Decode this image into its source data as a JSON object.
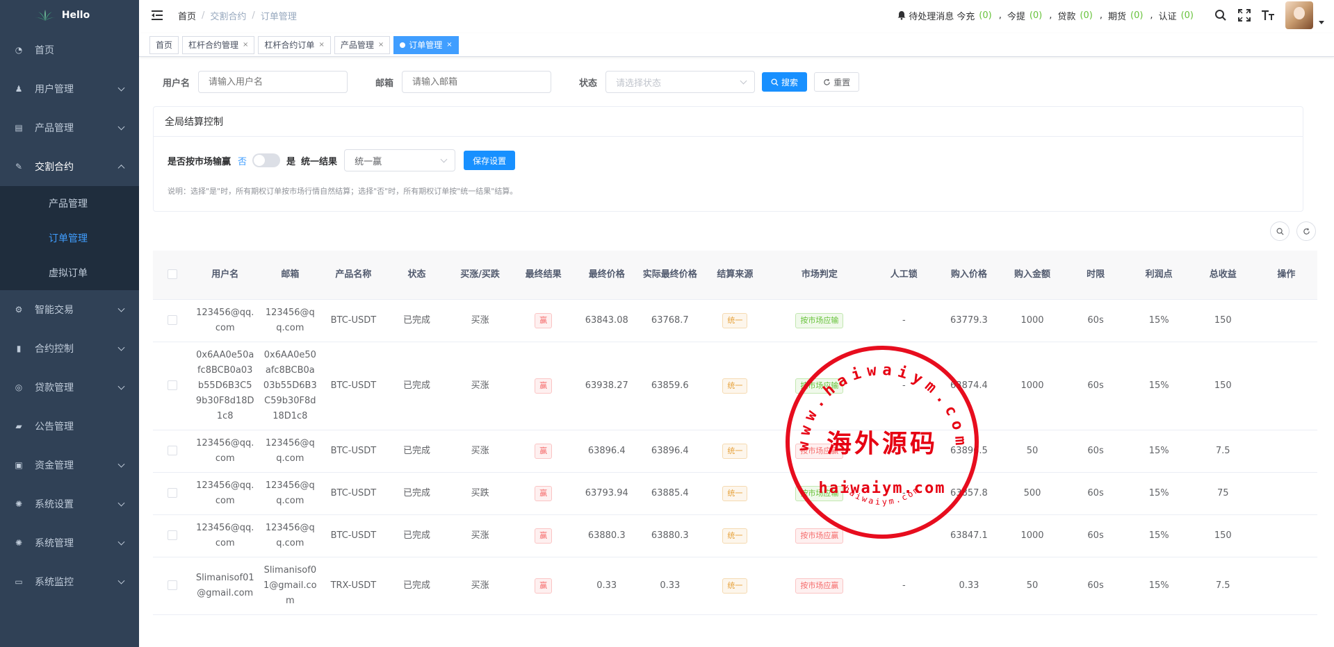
{
  "app": {
    "name": "Hello"
  },
  "sidebar": {
    "items": [
      {
        "key": "home",
        "label": "首页",
        "icon": "dashboard-icon",
        "glyph": "◔",
        "has_arrow": false
      },
      {
        "key": "users",
        "label": "用户管理",
        "icon": "user-icon",
        "glyph": "♟",
        "has_arrow": true
      },
      {
        "key": "products",
        "label": "产品管理",
        "icon": "document-icon",
        "glyph": "▤",
        "has_arrow": true
      },
      {
        "key": "trade",
        "label": "交割合约",
        "icon": "edit-icon",
        "glyph": "✎",
        "has_arrow": true,
        "open": true,
        "children": [
          {
            "key": "trade-products",
            "label": "产品管理",
            "active": false
          },
          {
            "key": "trade-orders",
            "label": "订单管理",
            "active": true
          },
          {
            "key": "trade-virtual",
            "label": "虚拟订单",
            "active": false
          }
        ]
      },
      {
        "key": "smart",
        "label": "智能交易",
        "icon": "cog-icon",
        "glyph": "⚙",
        "has_arrow": true
      },
      {
        "key": "contract",
        "label": "合约控制",
        "icon": "bar-chart-icon",
        "glyph": "▮",
        "has_arrow": true
      },
      {
        "key": "loan",
        "label": "贷款管理",
        "icon": "loan-icon",
        "glyph": "◎",
        "has_arrow": true
      },
      {
        "key": "notice",
        "label": "公告管理",
        "icon": "message-icon",
        "glyph": "▰",
        "has_arrow": false
      },
      {
        "key": "funds",
        "label": "资金管理",
        "icon": "money-icon",
        "glyph": "▣",
        "has_arrow": true
      },
      {
        "key": "settings",
        "label": "系统设置",
        "icon": "gear-icon",
        "glyph": "✺",
        "has_arrow": true
      },
      {
        "key": "system",
        "label": "系统管理",
        "icon": "system-icon",
        "glyph": "✺",
        "has_arrow": true
      },
      {
        "key": "monitor",
        "label": "系统监控",
        "icon": "monitor-icon",
        "glyph": "▭",
        "has_arrow": true
      }
    ]
  },
  "navbar": {
    "breadcrumb": [
      "首页",
      "交割合约",
      "订单管理"
    ],
    "pending": {
      "title": "待处理消息",
      "items": [
        {
          "label": "今充",
          "count": "(0)"
        },
        {
          "label": "今提",
          "count": "(0)"
        },
        {
          "label": "贷款",
          "count": "(0)"
        },
        {
          "label": "期货",
          "count": "(0)"
        },
        {
          "label": "认证",
          "count": "(0)"
        }
      ],
      "separator": ","
    }
  },
  "tags": [
    {
      "label": "首页",
      "closable": false,
      "active": false
    },
    {
      "label": "杠杆合约管理",
      "closable": true,
      "active": false
    },
    {
      "label": "杠杆合约订单",
      "closable": true,
      "active": false
    },
    {
      "label": "产品管理",
      "closable": true,
      "active": false
    },
    {
      "label": "订单管理",
      "closable": true,
      "active": true
    }
  ],
  "search": {
    "username_label": "用户名",
    "username_placeholder": "请输入用户名",
    "email_label": "邮箱",
    "email_placeholder": "请输入邮箱",
    "status_label": "状态",
    "status_placeholder": "请选择状态",
    "search_button": "搜索",
    "reset_button": "重置"
  },
  "settlement": {
    "title": "全局结算控制",
    "market_label": "是否按市场输赢",
    "no_label": "否",
    "yes_label": "是",
    "unified_label": "统一结果",
    "unified_value": "统一赢",
    "save_button": "保存设置",
    "note": "说明：选择\"是\"时，所有期权订单按市场行情自然结算；选择\"否\"时，所有期权订单按\"统一结果\"结算。"
  },
  "table": {
    "columns": [
      "",
      "用户名",
      "邮箱",
      "产品名称",
      "状态",
      "买涨/买跌",
      "最终结果",
      "最终价格",
      "实际最终价格",
      "结算来源",
      "市场判定",
      "人工锁",
      "购入价格",
      "购入金额",
      "时限",
      "利润点",
      "总收益",
      "操作"
    ],
    "rows": [
      {
        "username": "123456@qq.com",
        "email": "123456@qq.com",
        "product": "BTC-USDT",
        "status": "已完成",
        "direction": "买涨",
        "result": "赢",
        "final_price": "63843.08",
        "actual_price": "63768.7",
        "source": "统一",
        "market": "按市场应输",
        "market_color": "green",
        "lock": "-",
        "buy_price": "63779.3",
        "amount": "1000",
        "limit": "60s",
        "profit": "15%",
        "total": "150"
      },
      {
        "username": "0x6AA0e50afc8BCB0a03b55D6B3C59b30F8d18D1c8",
        "email": "0x6AA0e50afc8BCB0a03b55D6B3C59b30F8d18D1c8",
        "product": "BTC-USDT",
        "status": "已完成",
        "direction": "买涨",
        "result": "赢",
        "final_price": "63938.27",
        "actual_price": "63859.6",
        "source": "统一",
        "market": "按市场应输",
        "market_color": "green",
        "lock": "-",
        "buy_price": "63874.4",
        "amount": "1000",
        "limit": "60s",
        "profit": "15%",
        "total": "150"
      },
      {
        "username": "123456@qq.com",
        "email": "123456@qq.com",
        "product": "BTC-USDT",
        "status": "已完成",
        "direction": "买涨",
        "result": "赢",
        "final_price": "63896.4",
        "actual_price": "63896.4",
        "source": "统一",
        "market": "按市场应赢",
        "market_color": "red",
        "lock": "-",
        "buy_price": "63896.5",
        "amount": "50",
        "limit": "60s",
        "profit": "15%",
        "total": "7.5"
      },
      {
        "username": "123456@qq.com",
        "email": "123456@qq.com",
        "product": "BTC-USDT",
        "status": "已完成",
        "direction": "买跌",
        "result": "赢",
        "final_price": "63793.94",
        "actual_price": "63885.4",
        "source": "统一",
        "market": "按市场应输",
        "market_color": "green",
        "lock": "-",
        "buy_price": "63857.8",
        "amount": "500",
        "limit": "60s",
        "profit": "15%",
        "total": "75"
      },
      {
        "username": "123456@qq.com",
        "email": "123456@qq.com",
        "product": "BTC-USDT",
        "status": "已完成",
        "direction": "买涨",
        "result": "赢",
        "final_price": "63880.3",
        "actual_price": "63880.3",
        "source": "统一",
        "market": "按市场应赢",
        "market_color": "red",
        "lock": "-",
        "buy_price": "63847.1",
        "amount": "1000",
        "limit": "60s",
        "profit": "15%",
        "total": "150"
      },
      {
        "username": "Slimanisof01@gmail.com",
        "email": "Slimanisof01@gmail.com",
        "product": "TRX-USDT",
        "status": "已完成",
        "direction": "买涨",
        "result": "赢",
        "final_price": "0.33",
        "actual_price": "0.33",
        "source": "统一",
        "market": "按市场应赢",
        "market_color": "red",
        "lock": "-",
        "buy_price": "0.33",
        "amount": "50",
        "limit": "60s",
        "profit": "15%",
        "total": "7.5"
      }
    ]
  },
  "watermark": {
    "top_text": "www.haiwaiym.com",
    "center_text": "海外源码",
    "mid_text": "haiwaiym.com",
    "bottom_text": "haiwaiym.com",
    "color": "#e60012"
  },
  "colors": {
    "sidebar_bg": "#304156",
    "submenu_bg": "#1f2d3d",
    "primary": "#1890ff",
    "success": "#67c23a",
    "danger": "#f56c6c",
    "warning": "#e6a23c"
  }
}
